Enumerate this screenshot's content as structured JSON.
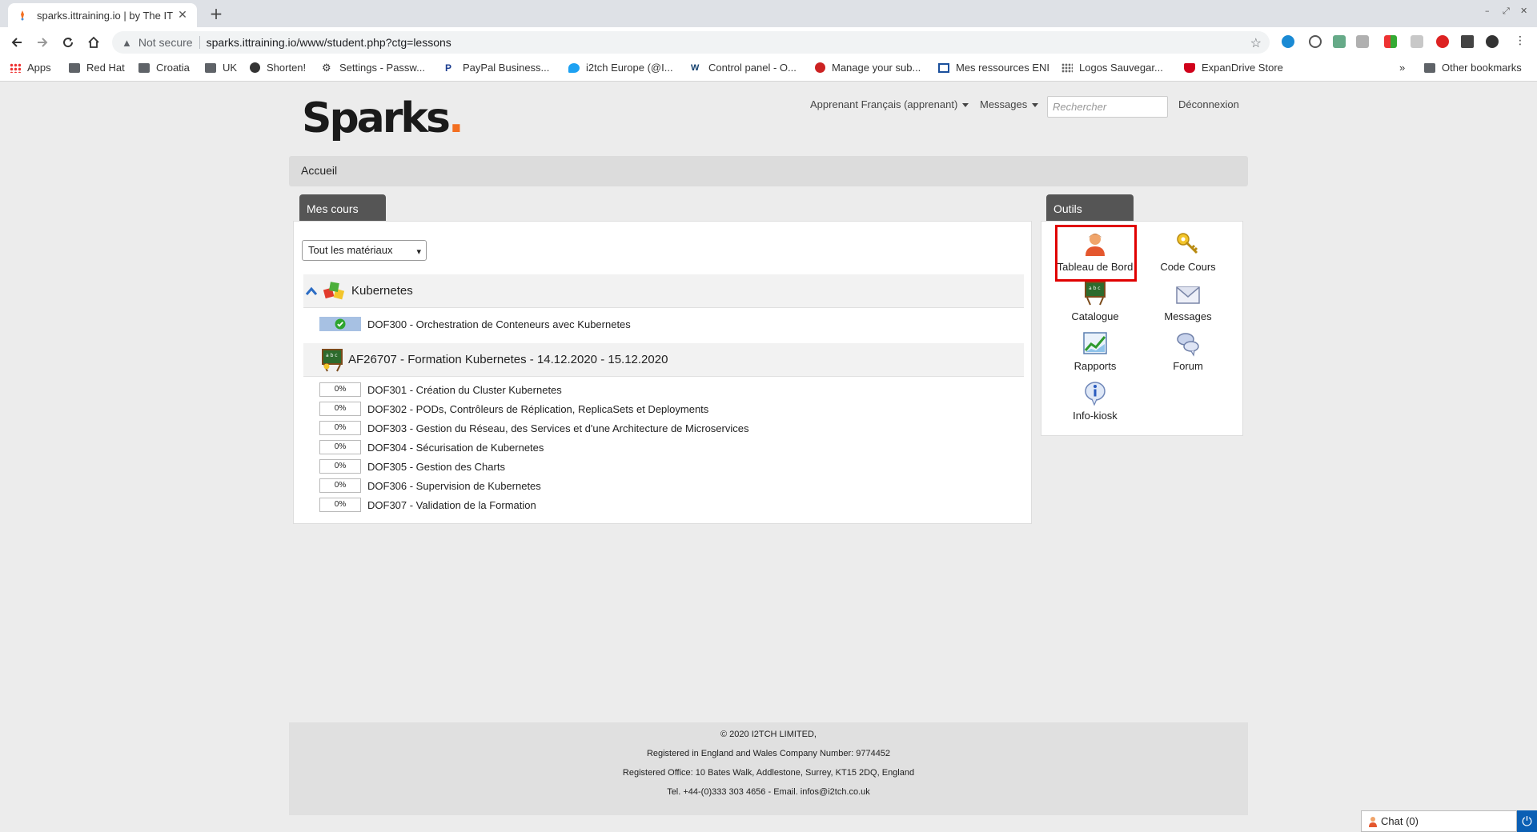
{
  "browser": {
    "tab_title": "sparks.ittraining.io | by The IT",
    "address": {
      "security_label": "Not secure",
      "url": "sparks.ittraining.io/www/student.php?ctg=lessons"
    },
    "bookmarks": [
      {
        "label": "Apps",
        "icon": "apps-grid-icon"
      },
      {
        "label": "Red Hat",
        "icon": "folder-icon"
      },
      {
        "label": "Croatia",
        "icon": "folder-icon"
      },
      {
        "label": "UK",
        "icon": "folder-icon"
      },
      {
        "label": "Shorten!",
        "icon": "globe-icon"
      },
      {
        "label": "Settings - Passw...",
        "icon": "gear-icon"
      },
      {
        "label": "PayPal Business...",
        "icon": "paypal-icon"
      },
      {
        "label": "i2tch Europe (@I...",
        "icon": "twitter-icon"
      },
      {
        "label": "Control panel - O...",
        "icon": "ovh-icon"
      },
      {
        "label": "Manage your sub...",
        "icon": "vivaldi-icon"
      },
      {
        "label": "Mes ressources ENI",
        "icon": "eni-icon"
      },
      {
        "label": "Logos Sauvegar...",
        "icon": "grid-dots-icon"
      },
      {
        "label": "ExpanDrive Store",
        "icon": "expandrive-icon"
      }
    ],
    "more_bookmarks": "»",
    "other_bookmarks": "Other bookmarks"
  },
  "site": {
    "logo_text": "Sparks",
    "logo_dot": ".",
    "logo_accent": "#f36f21",
    "user_menu": "Apprenant Français (apprenant)",
    "messages_menu": "Messages",
    "search_placeholder": "Rechercher",
    "logout": "Déconnexion",
    "breadcrumb": "Accueil"
  },
  "courses": {
    "panel_title": "Mes cours",
    "filter_value": "Tout les matériaux",
    "groups": [
      {
        "title": "Kubernetes",
        "items": [
          {
            "progress": "",
            "completed": true,
            "label": "DOF300 - Orchestration de Conteneurs avec Kubernetes"
          }
        ]
      },
      {
        "title": "AF26707 - Formation Kubernetes - 14.12.2020 - 15.12.2020",
        "items": [
          {
            "progress": "0%",
            "label": "DOF301 - Création du Cluster Kubernetes"
          },
          {
            "progress": "0%",
            "label": "DOF302 - PODs, Contrôleurs de Réplication, ReplicaSets et Deployments"
          },
          {
            "progress": "0%",
            "label": "DOF303 - Gestion du Réseau, des Services et d'une Architecture de Microservices"
          },
          {
            "progress": "0%",
            "label": "DOF304 - Sécurisation de Kubernetes"
          },
          {
            "progress": "0%",
            "label": "DOF305 - Gestion des Charts"
          },
          {
            "progress": "0%",
            "label": "DOF306 - Supervision de Kubernetes"
          },
          {
            "progress": "0%",
            "label": "DOF307 - Validation de la Formation"
          }
        ]
      }
    ]
  },
  "tools": {
    "panel_title": "Outils",
    "items": [
      {
        "label": "Tableau de Bord",
        "icon": "user-dashboard-icon"
      },
      {
        "label": "Code Cours",
        "icon": "key-icon"
      },
      {
        "label": "Catalogue",
        "icon": "chalkboard-icon"
      },
      {
        "label": "Messages",
        "icon": "envelope-icon"
      },
      {
        "label": "Rapports",
        "icon": "chart-icon"
      },
      {
        "label": "Forum",
        "icon": "speech-bubbles-icon"
      },
      {
        "label": "Info-kiosk",
        "icon": "info-icon"
      }
    ],
    "highlight_color": "#e00000"
  },
  "footer": {
    "lines": [
      "© 2020 I2TCH LIMITED,",
      "Registered in England and Wales Company Number: 9774452",
      "Registered Office: 10 Bates Walk, Addlestone, Surrey, KT15 2DQ, England",
      "Tel. +44-(0)333 303 4656 - Email. infos@i2tch.co.uk"
    ]
  },
  "chat": {
    "label": "Chat (0)"
  }
}
